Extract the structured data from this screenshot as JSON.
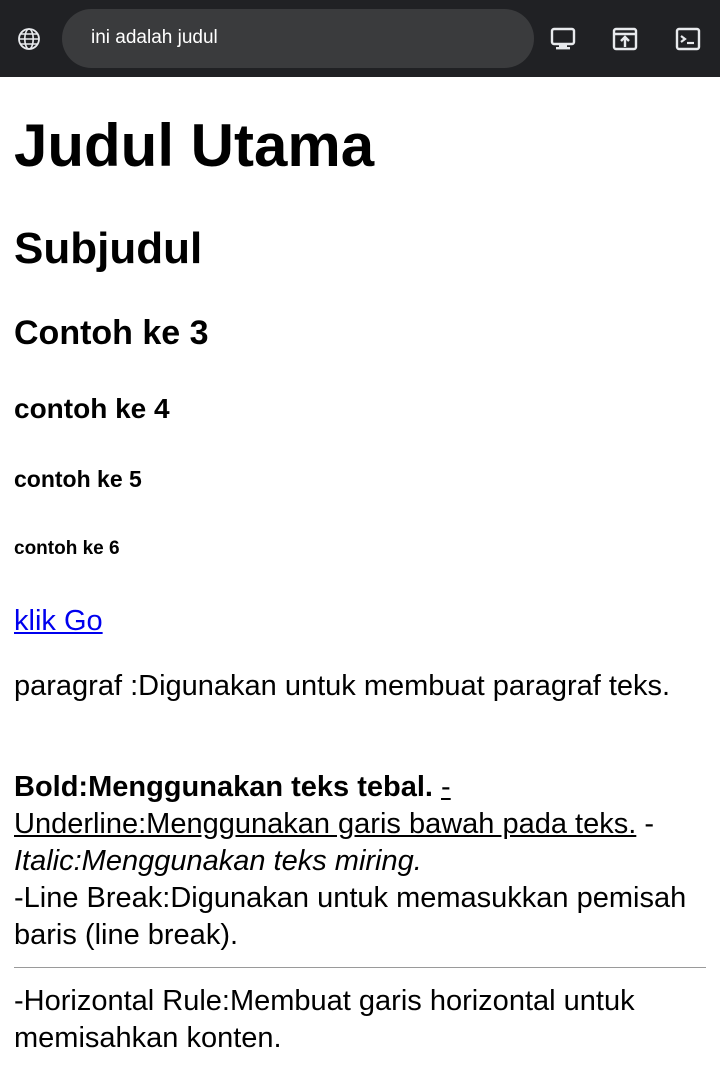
{
  "browser": {
    "url_text": "ini adalah judul",
    "icons": [
      "globe-icon",
      "desktop-icon",
      "open-in-new-icon",
      "terminal-icon"
    ],
    "bar_color": "#202124",
    "urlbar_color": "#3a3b3d"
  },
  "page": {
    "h1": "Judul Utama",
    "h2": "Subjudul",
    "h3": "Contoh ke 3",
    "h4": "contoh ke 4",
    "h5": "contoh ke 5",
    "h6": "contoh ke 6",
    "link": "klik Go",
    "link_color": "#0000ee",
    "paragraph": "paragraf :Digunakan untuk membuat paragraf teks.",
    "bold_text": "Bold:Menggunakan teks tebal.",
    "underline_text": "-Underline:Menggunakan garis bawah pada teks.",
    "italic_prefix": "-",
    "italic_text": "Italic:Menggunakan teks miring.",
    "line_break_text": "-Line Break:Digunakan untuk memasukkan pemisah baris (line break).",
    "hr_text": "-Horizontal Rule:Membuat garis horizontal untuk memisahkan konten."
  }
}
